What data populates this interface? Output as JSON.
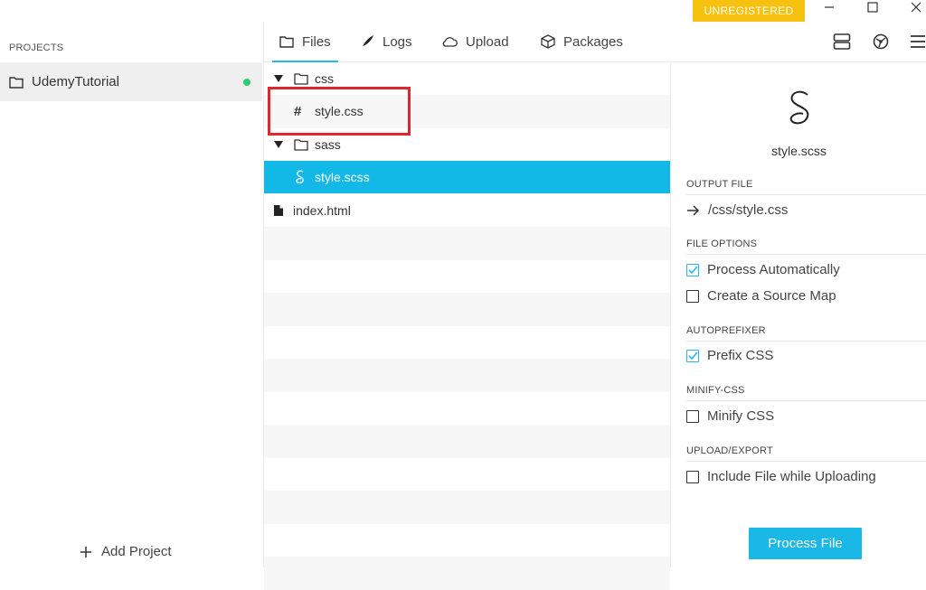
{
  "window": {
    "unregistered_label": "UNREGISTERED",
    "colors": {
      "badge": "#f6c10f",
      "accent": "#26b7e8",
      "selection": "#12b9e6",
      "status_ok": "#2ecc71",
      "highlight": "#e0262b"
    }
  },
  "sidebar": {
    "projects_label": "PROJECTS",
    "project": {
      "name": "UdemyTutorial",
      "status": "active"
    },
    "add_project_label": "Add Project"
  },
  "tabs": [
    {
      "label": "Files",
      "icon": "folder-icon",
      "active": true
    },
    {
      "label": "Logs",
      "icon": "quill-icon",
      "active": false
    },
    {
      "label": "Upload",
      "icon": "cloud-icon",
      "active": false
    },
    {
      "label": "Packages",
      "icon": "package-icon",
      "active": false
    }
  ],
  "toolbar_icons": [
    "server-icon",
    "network-icon",
    "menu-icon"
  ],
  "tree": [
    {
      "label": "css",
      "type": "folder",
      "expanded": true,
      "icon": "folder-icon"
    },
    {
      "label": "style.css",
      "type": "css",
      "icon": "hash-icon",
      "highlighted": true
    },
    {
      "label": "sass",
      "type": "folder",
      "expanded": true,
      "icon": "folder-icon"
    },
    {
      "label": "style.scss",
      "type": "scss",
      "icon": "sass-icon",
      "selected": true
    },
    {
      "label": "index.html",
      "type": "html",
      "icon": "file-icon"
    }
  ],
  "details": {
    "file_name": "style.scss",
    "output_section": "OUTPUT FILE",
    "output_path": "/css/style.css",
    "file_options_section": "FILE OPTIONS",
    "process_automatically": {
      "label": "Process Automatically",
      "checked": true
    },
    "source_map": {
      "label": "Create a Source Map",
      "checked": false
    },
    "autoprefixer_section": "AUTOPREFIXER",
    "prefix_css": {
      "label": "Prefix CSS",
      "checked": true
    },
    "minify_section": "MINIFY-CSS",
    "minify_css": {
      "label": "Minify CSS",
      "checked": false
    },
    "upload_section": "UPLOAD/EXPORT",
    "include_upload": {
      "label": "Include File while Uploading",
      "checked": false
    },
    "process_button": "Process File"
  }
}
